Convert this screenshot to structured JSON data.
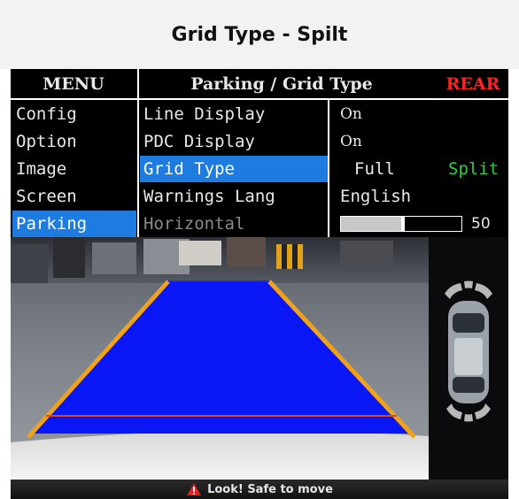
{
  "page_title": "Grid Type - Spilt",
  "menu": {
    "header": "MENU",
    "items": [
      {
        "label": "Config"
      },
      {
        "label": "Option"
      },
      {
        "label": "Image"
      },
      {
        "label": "Screen"
      },
      {
        "label": "Parking"
      }
    ],
    "selected": "Parking"
  },
  "settings": {
    "header": "Parking / Grid Type",
    "mode": "REAR",
    "rows": [
      {
        "label": "Line Display",
        "value": "On"
      },
      {
        "label": "PDC Display",
        "value": "On"
      },
      {
        "label": "Grid Type",
        "options": [
          "Full",
          "Split"
        ],
        "active_option": "Split"
      },
      {
        "label": "Warnings Lang",
        "value": "English"
      },
      {
        "label": "Horizontal",
        "slider_value": "50",
        "slider_fraction": 0.5
      }
    ],
    "selected": "Grid Type"
  },
  "warning": {
    "text": "Look! Safe to move",
    "icon": "warning-triangle-icon"
  },
  "colors": {
    "selection": "#1e7be0",
    "active_option": "#27d23e",
    "mode": "#ff2222",
    "grid_fill": "#0a17f5",
    "grid_edge": "#f0a21a"
  }
}
